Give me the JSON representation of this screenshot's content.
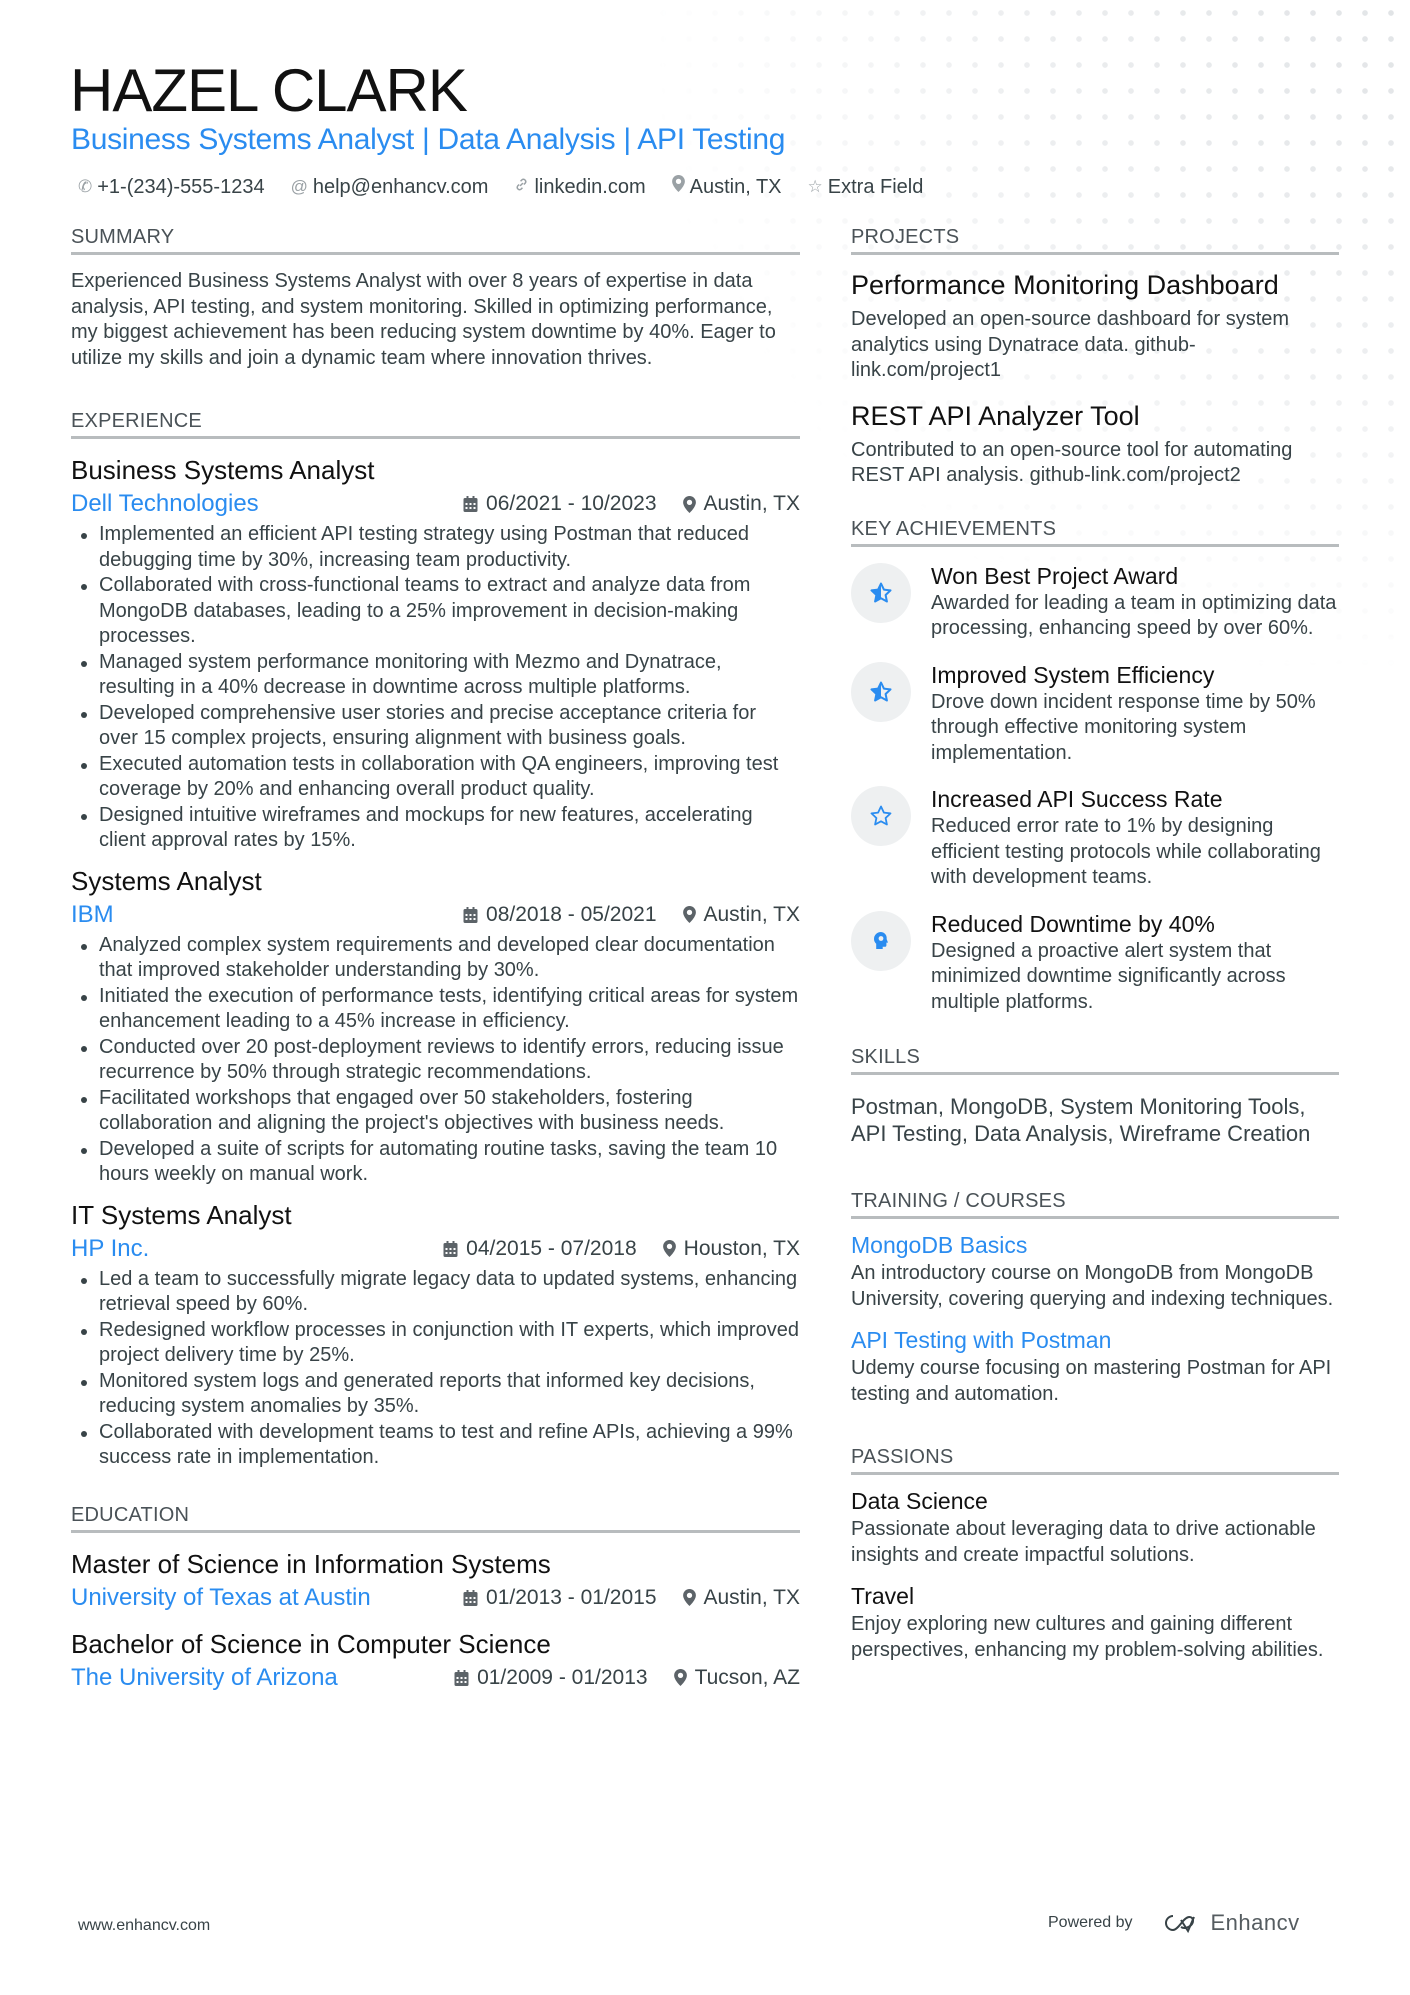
{
  "header": {
    "name": "HAZEL CLARK",
    "subtitle": "Business Systems Analyst | Data Analysis | API Testing",
    "contacts": [
      {
        "icon": "phone-icon",
        "glyph": "✆",
        "text": "+1-(234)-555-1234"
      },
      {
        "icon": "at-icon",
        "glyph": "@",
        "text": "help@enhancv.com"
      },
      {
        "icon": "link-icon",
        "glyph": "🔗︎",
        "text": "linkedin.com"
      },
      {
        "icon": "location-pin-icon",
        "glyph": "⚲",
        "text": "Austin, TX"
      },
      {
        "icon": "star-icon",
        "glyph": "☆",
        "text": "Extra Field"
      }
    ]
  },
  "summary": {
    "heading": "SUMMARY",
    "text": "Experienced Business Systems Analyst with over 8 years of expertise in data analysis, API testing, and system monitoring. Skilled in optimizing performance, my biggest achievement has been reducing system downtime by 40%. Eager to utilize my skills and join a dynamic team where innovation thrives."
  },
  "experience": {
    "heading": "EXPERIENCE",
    "jobs": [
      {
        "title": "Business Systems Analyst",
        "company": "Dell Technologies",
        "dates": "06/2021 - 10/2023",
        "location": "Austin, TX",
        "bullets": [
          "Implemented an efficient API testing strategy using Postman that reduced debugging time by 30%, increasing team productivity.",
          "Collaborated with cross-functional teams to extract and analyze data from MongoDB databases, leading to a 25% improvement in decision-making processes.",
          "Managed system performance monitoring with Mezmo and Dynatrace, resulting in a 40% decrease in downtime across multiple platforms.",
          "Developed comprehensive user stories and precise acceptance criteria for over 15 complex projects, ensuring alignment with business goals.",
          "Executed automation tests in collaboration with QA engineers, improving test coverage by 20% and enhancing overall product quality.",
          "Designed intuitive wireframes and mockups for new features, accelerating client approval rates by 15%."
        ]
      },
      {
        "title": "Systems Analyst",
        "company": "IBM",
        "dates": "08/2018 - 05/2021",
        "location": "Austin, TX",
        "bullets": [
          "Analyzed complex system requirements and developed clear documentation that improved stakeholder understanding by 30%.",
          "Initiated the execution of performance tests, identifying critical areas for system enhancement leading to a 45% increase in efficiency.",
          "Conducted over 20 post-deployment reviews to identify errors, reducing issue recurrence by 50% through strategic recommendations.",
          "Facilitated workshops that engaged over 50 stakeholders, fostering collaboration and aligning the project's objectives with business needs.",
          "Developed a suite of scripts for automating routine tasks, saving the team 10 hours weekly on manual work."
        ]
      },
      {
        "title": "IT Systems Analyst",
        "company": "HP Inc.",
        "dates": "04/2015 - 07/2018",
        "location": "Houston, TX",
        "bullets": [
          "Led a team to successfully migrate legacy data to updated systems, enhancing retrieval speed by 60%.",
          "Redesigned workflow processes in conjunction with IT experts, which improved project delivery time by 25%.",
          "Monitored system logs and generated reports that informed key decisions, reducing system anomalies by 35%.",
          "Collaborated with development teams to test and refine APIs, achieving a 99% success rate in implementation."
        ]
      }
    ]
  },
  "education": {
    "heading": "EDUCATION",
    "items": [
      {
        "degree": "Master of Science in Information Systems",
        "school": "University of Texas at Austin",
        "dates": "01/2013 - 01/2015",
        "location": "Austin, TX"
      },
      {
        "degree": "Bachelor of Science in Computer Science",
        "school": "The University of Arizona",
        "dates": "01/2009 - 01/2013",
        "location": "Tucson, AZ"
      }
    ]
  },
  "projects": {
    "heading": "PROJECTS",
    "items": [
      {
        "title": "Performance Monitoring Dashboard",
        "description": "Developed an open-source dashboard for system analytics using Dynatrace data. github-link.com/project1"
      },
      {
        "title": "REST API Analyzer Tool",
        "description": "Contributed to an open-source tool for automating REST API analysis. github-link.com/project2"
      }
    ]
  },
  "achievements": {
    "heading": "KEY ACHIEVEMENTS",
    "items": [
      {
        "icon": "star-half-icon",
        "title": "Won Best Project Award",
        "description": "Awarded for leading a team in optimizing data processing, enhancing speed by over 60%."
      },
      {
        "icon": "star-half-icon",
        "title": "Improved System Efficiency",
        "description": "Drove down incident response time by 50% through effective monitoring system implementation."
      },
      {
        "icon": "star-outline-icon",
        "title": "Increased API Success Rate",
        "description": "Reduced error rate to 1% by designing efficient testing protocols while collaborating with development teams."
      },
      {
        "icon": "head-bulb-icon",
        "title": "Reduced Downtime by 40%",
        "description": "Designed a proactive alert system that minimized downtime significantly across multiple platforms."
      }
    ]
  },
  "skills": {
    "heading": "SKILLS",
    "text": "Postman, MongoDB, System Monitoring Tools, API Testing, Data Analysis, Wireframe Creation"
  },
  "training": {
    "heading": "TRAINING / COURSES",
    "items": [
      {
        "title": "MongoDB Basics",
        "description": "An introductory course on MongoDB from MongoDB University, covering querying and indexing techniques."
      },
      {
        "title": "API Testing with Postman",
        "description": "Udemy course focusing on mastering Postman for API testing and automation."
      }
    ]
  },
  "passions": {
    "heading": "PASSIONS",
    "items": [
      {
        "title": "Data Science",
        "description": "Passionate about leveraging data to drive actionable insights and create impactful solutions."
      },
      {
        "title": "Travel",
        "description": "Enjoy exploring new cultures and gaining different perspectives, enhancing my problem-solving abilities."
      }
    ]
  },
  "footer": {
    "website": "www.enhancv.com",
    "powered_by": "Powered by",
    "brand": "Enhancv"
  },
  "colors": {
    "accent": "#2a8cf0",
    "text": "#384347",
    "heading": "#111111",
    "divider": "#b8bcbe",
    "badge_bg": "#eef0f1"
  }
}
